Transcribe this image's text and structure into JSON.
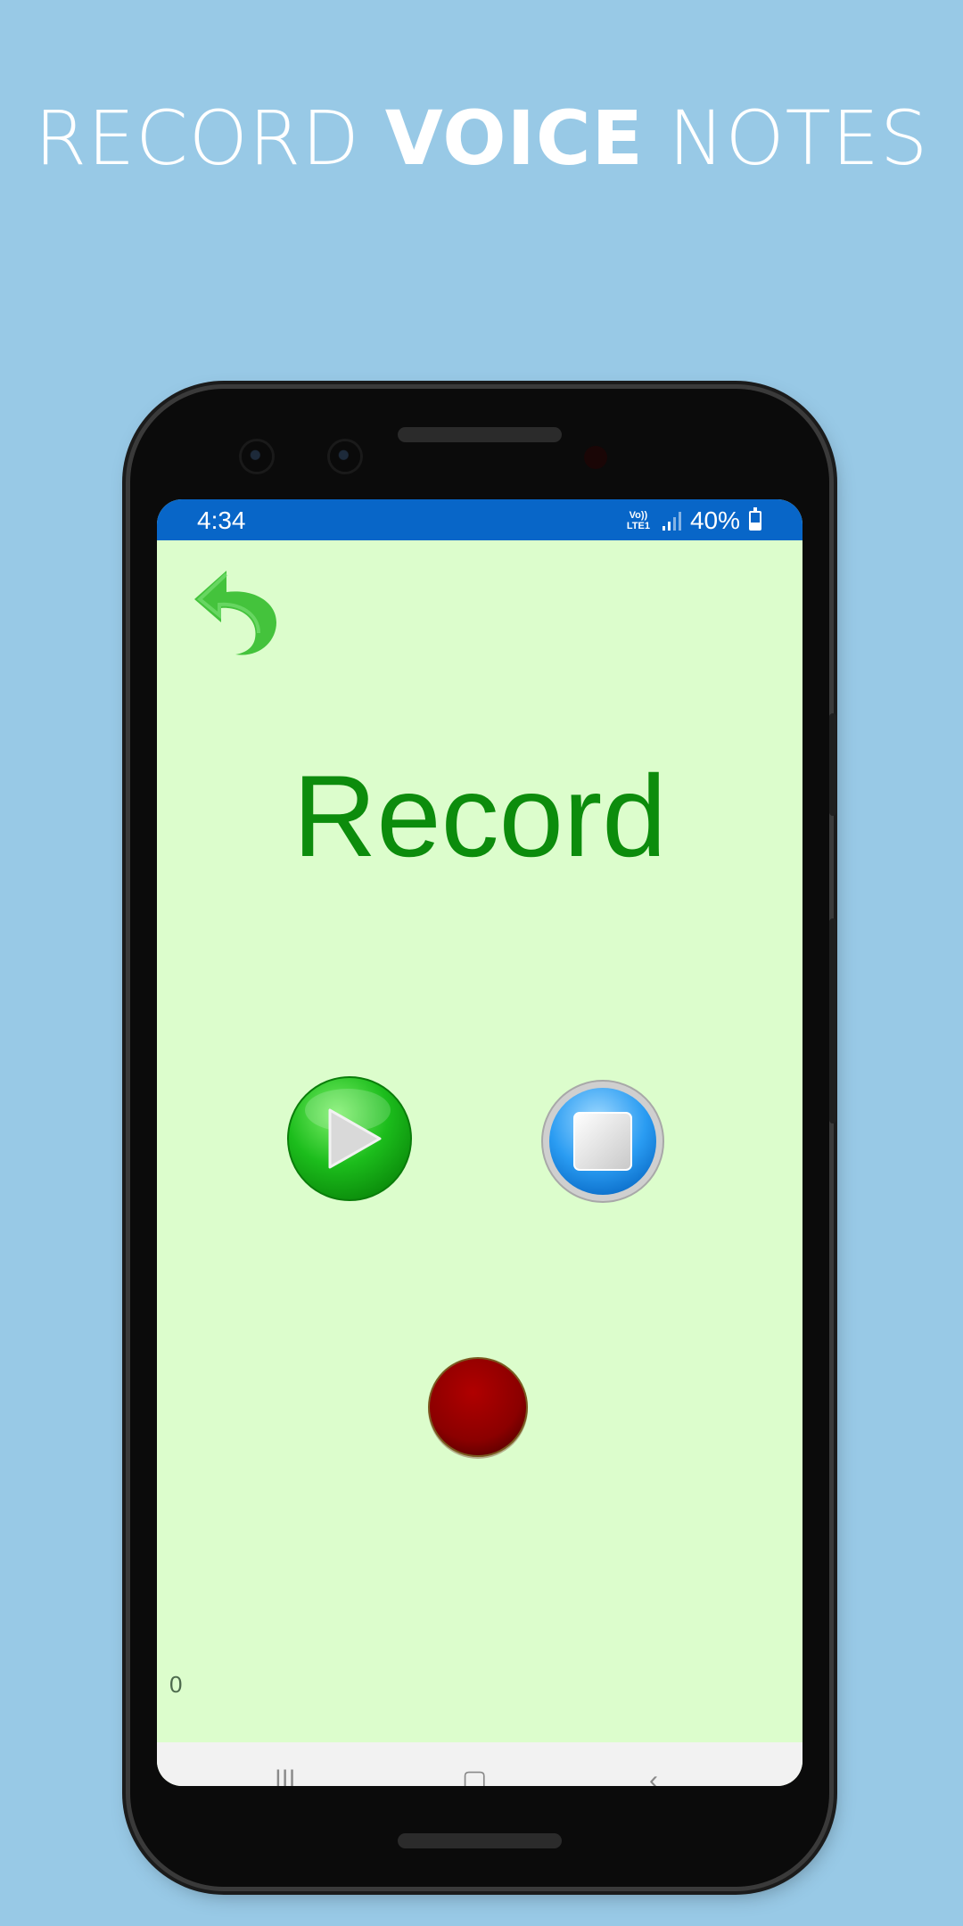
{
  "headline": {
    "part1": "RECORD ",
    "part2": "VOICE",
    "part3": " NOTES"
  },
  "status_bar": {
    "time": "4:34",
    "network": "Vo)) LTE1",
    "battery": "40%",
    "battery_level": 0.4
  },
  "app": {
    "title": "Record",
    "counter": "0"
  },
  "icons": {
    "back": "undo-arrow-icon",
    "play": "play-icon",
    "stop": "stop-icon",
    "record": "record-icon"
  },
  "colors": {
    "page_background": "#98c9e6",
    "screen_background": "#dcfdcc",
    "status_bar": "#0866c8",
    "title": "#0c8c0c",
    "record": "#8b0000"
  }
}
